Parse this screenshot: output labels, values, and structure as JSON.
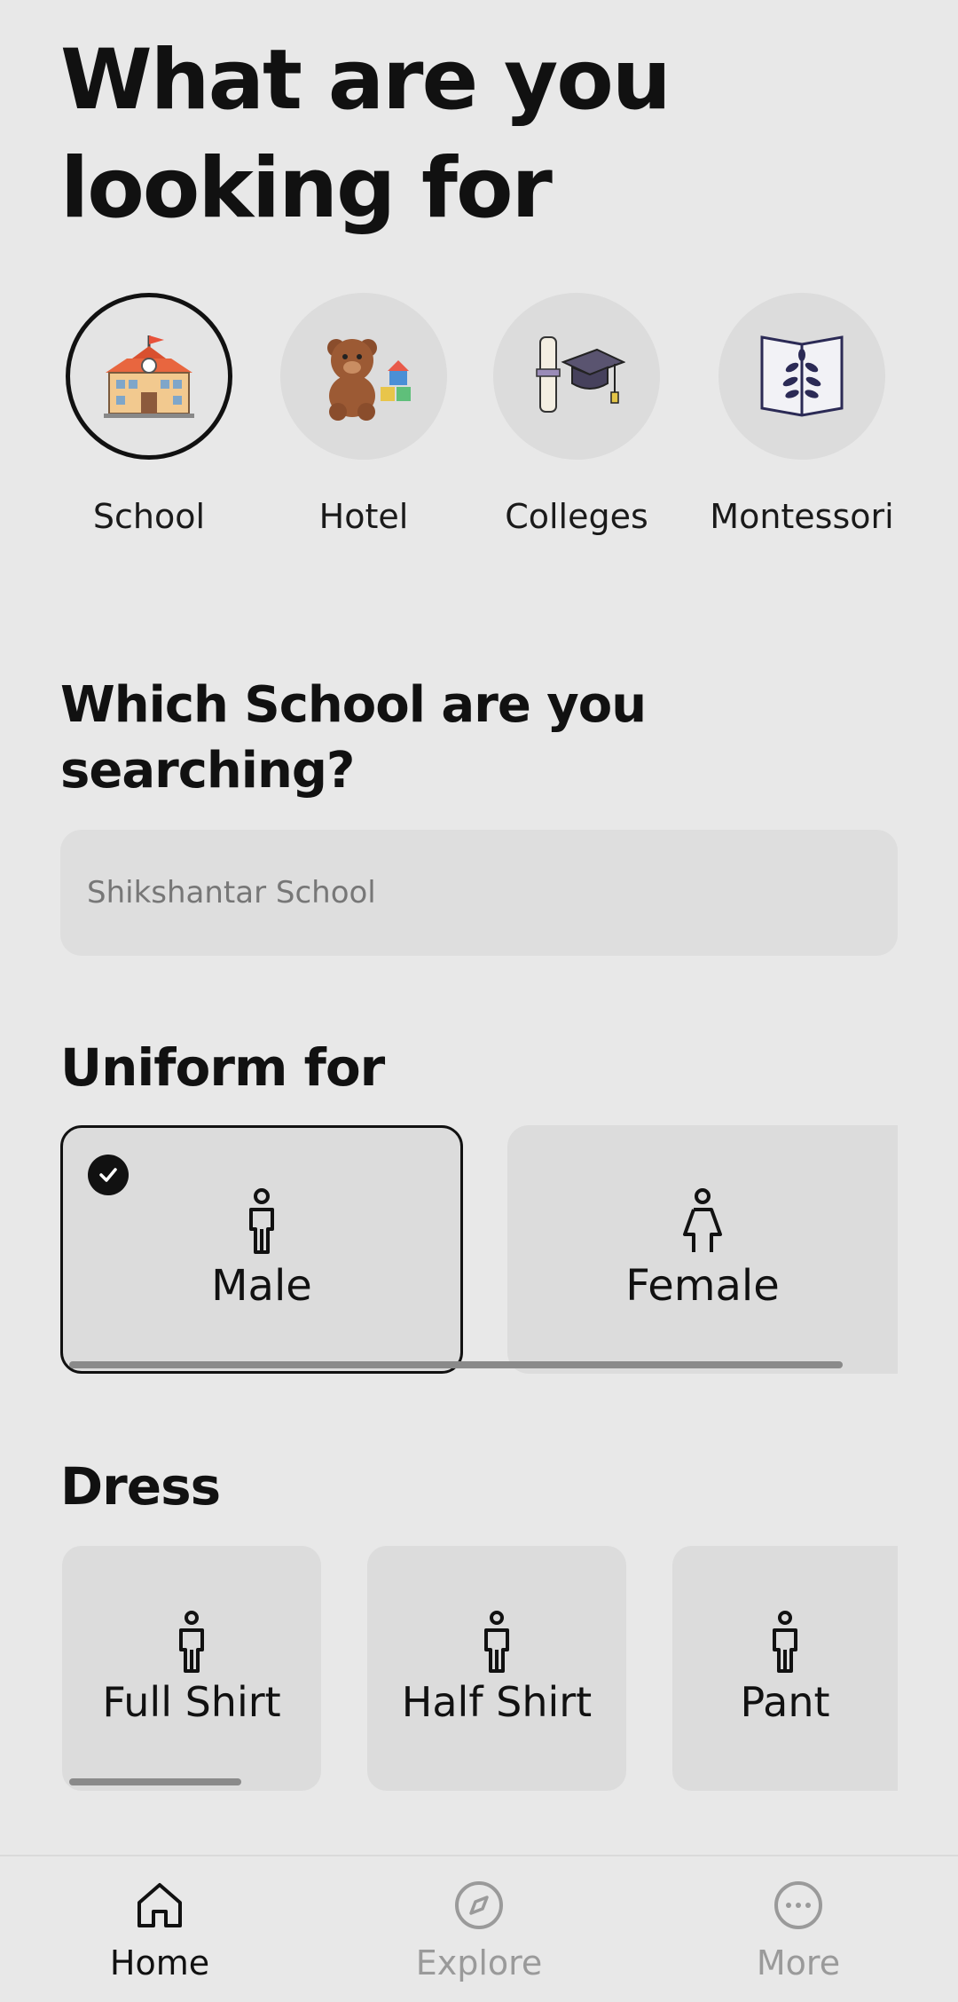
{
  "header": {
    "title": "What are you looking for"
  },
  "categories": [
    {
      "label": "School",
      "icon": "school-building-icon",
      "selected": true
    },
    {
      "label": "Hotel",
      "icon": "teddy-bear-icon",
      "selected": false
    },
    {
      "label": "Colleges",
      "icon": "graduation-cap-icon",
      "selected": false
    },
    {
      "label": "Montessori",
      "icon": "book-plant-icon",
      "selected": false
    }
  ],
  "search": {
    "heading": "Which School are you searching?",
    "placeholder": "Shikshantar School"
  },
  "uniform": {
    "heading": "Uniform for",
    "options": [
      {
        "label": "Male",
        "icon": "male-person-icon",
        "selected": true
      },
      {
        "label": "Female",
        "icon": "female-person-icon",
        "selected": false
      }
    ]
  },
  "dress": {
    "heading": "Dress",
    "options": [
      {
        "label": "Full Shirt",
        "icon": "person-icon"
      },
      {
        "label": "Half Shirt",
        "icon": "person-icon"
      },
      {
        "label": "Pant",
        "icon": "person-icon"
      }
    ]
  },
  "bottom_nav": [
    {
      "label": "Home",
      "icon": "home-icon",
      "active": true
    },
    {
      "label": "Explore",
      "icon": "compass-icon",
      "active": false
    },
    {
      "label": "More",
      "icon": "more-dots-icon",
      "active": false
    }
  ],
  "colors": {
    "accent": "#111111",
    "card": "#dcdcdc",
    "background": "#e8e8e8",
    "inactive": "#9a9a9a"
  }
}
